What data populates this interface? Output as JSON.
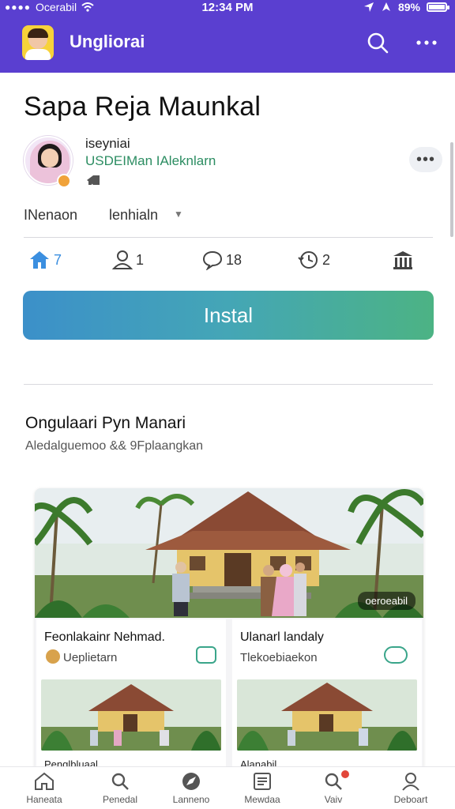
{
  "status_bar": {
    "carrier": "Ocerabil",
    "time": "12:34 PM",
    "battery": "89%",
    "battery_level": 0.89
  },
  "app_bar": {
    "title": "Ungliorai"
  },
  "page": {
    "title": "Sapa Reja Maunkal",
    "author_name": "iseyniai",
    "author_sub": "USDEIMan IAleknlarn",
    "filter_primary": "INenaon",
    "filter_secondary": "lenhialn"
  },
  "stats": {
    "home_count": "7",
    "users_count": "1",
    "comments_count": "18",
    "history_count": "2"
  },
  "actions": {
    "install_label": "Instal"
  },
  "section": {
    "title": "Ongulaari Pyn Manari",
    "subtitle": "Aledalguemoo && 9Fplaangkan"
  },
  "hero": {
    "badge": "oeroeabil"
  },
  "cards": [
    {
      "title": "Feonlakainr Nehmad.",
      "meta": "Ueplietarn",
      "footer": "Penglbluaal"
    },
    {
      "title": "Ulanarl landaly",
      "meta": "Tlekoebiaekon",
      "footer": "Alanabil"
    }
  ],
  "bottom_nav": [
    {
      "label": "Haneata",
      "icon": "home-icon"
    },
    {
      "label": "Penedal",
      "icon": "search-icon"
    },
    {
      "label": "Lanneno",
      "icon": "compass-icon"
    },
    {
      "label": "Mewdaa",
      "icon": "document-icon"
    },
    {
      "label": "Vaiv",
      "icon": "magnify-alert-icon"
    },
    {
      "label": "Deboart",
      "icon": "profile-icon"
    }
  ],
  "colors": {
    "brand_purple": "#5a3fd0",
    "accent_blue": "#3c90c9",
    "accent_green": "#4cb384",
    "text_green": "#2c8d62"
  }
}
